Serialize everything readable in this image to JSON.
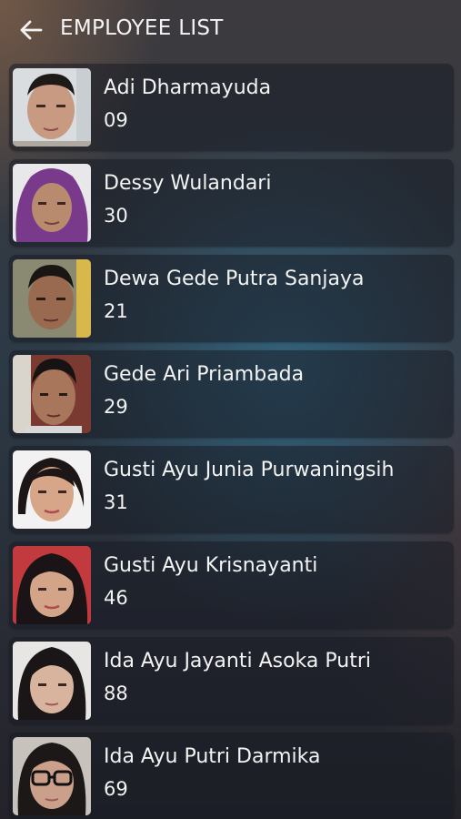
{
  "header": {
    "title": "EMPLOYEE LIST",
    "back_icon": "arrow-left-icon"
  },
  "employees": [
    {
      "name": "Adi Dharmayuda",
      "number": "09"
    },
    {
      "name": "Dessy Wulandari",
      "number": "30"
    },
    {
      "name": "Dewa Gede Putra Sanjaya",
      "number": "21"
    },
    {
      "name": "Gede Ari Priambada",
      "number": "29"
    },
    {
      "name": "Gusti Ayu Junia Purwaningsih",
      "number": "31"
    },
    {
      "name": "Gusti Ayu Krisnayanti",
      "number": "46"
    },
    {
      "name": "Ida Ayu Jayanti Asoka Putri",
      "number": "88"
    },
    {
      "name": "Ida Ayu Putri Darmika",
      "number": "69"
    }
  ]
}
